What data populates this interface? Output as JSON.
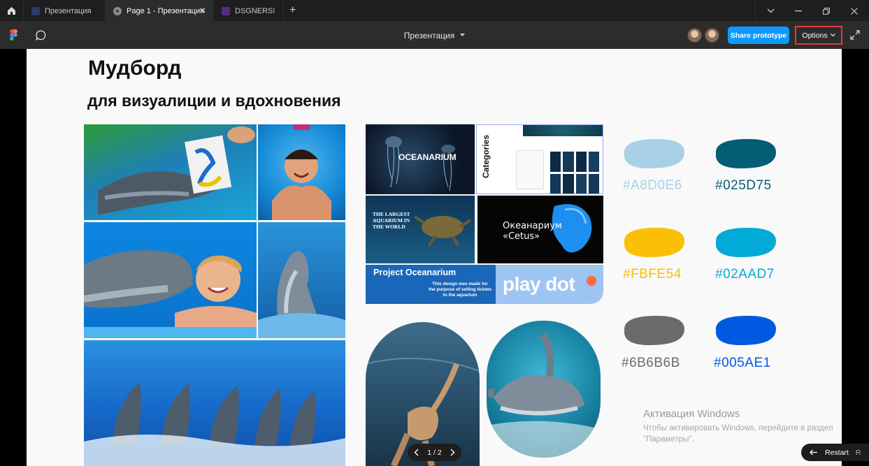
{
  "tabs": [
    {
      "label": "Презентация",
      "active": false,
      "fav_color": "#2d3a6a"
    },
    {
      "label": "Page 1 - Презентация",
      "active": true,
      "fav_color": "#6c6c6c"
    },
    {
      "label": "DSGNERS!",
      "active": false,
      "fav_color": "#5a2a80"
    }
  ],
  "toolbar": {
    "doc_title": "Презентация",
    "share_label": "Share prototype",
    "options_label": "Options"
  },
  "moodboard": {
    "title": "Мудборд",
    "subtitle": "для визуалиции и вдохновения"
  },
  "cards": {
    "oceanarium": "OCEANARIUM",
    "categories": "Categories",
    "largest_aquarium": "THE LARGEST AQUARIUM IN THE WORLD",
    "cetus": "Океанариум «Cetus»",
    "project_title": "Project Oceanarium",
    "project_desc": "This design was made for the purpose of selling tickets to the aquarium",
    "playdot": "play dot"
  },
  "palette": [
    {
      "hex": "#A8D0E6"
    },
    {
      "hex": "#025D75"
    },
    {
      "hex": "#FBFE54"
    },
    {
      "hex": "#02AAD7"
    },
    {
      "hex": "#6B6B6B"
    },
    {
      "hex": "#005AE1"
    }
  ],
  "palette_colors": [
    "#A8D0E6",
    "#025D75",
    "#FBBF05",
    "#02AAD7",
    "#6B6B6B",
    "#005AE1"
  ],
  "watermark": {
    "title": "Активация Windows",
    "text": "Чтобы активировать Windows, перейдите в раздел \"Параметры\"."
  },
  "pager": {
    "label": "1 / 2"
  },
  "restart": {
    "label": "Restart",
    "key": "R"
  }
}
